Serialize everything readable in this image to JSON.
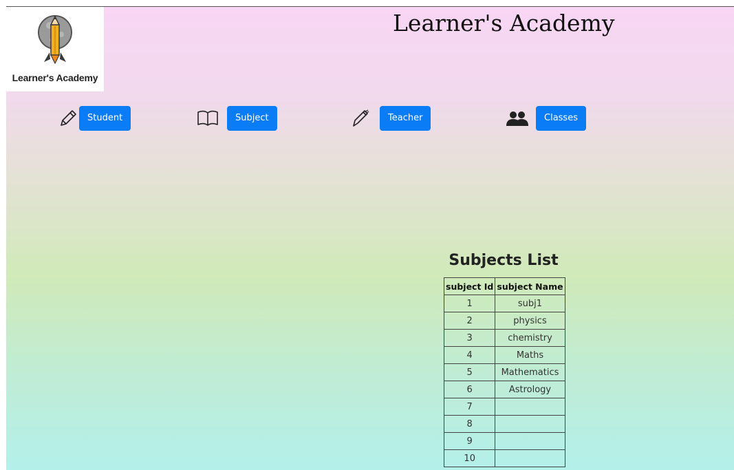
{
  "logo": {
    "text": "Learner's Academy"
  },
  "header": {
    "title": "Learner's Academy"
  },
  "nav": [
    {
      "label": "Student",
      "icon": "pencil-icon"
    },
    {
      "label": "Subject",
      "icon": "book-icon"
    },
    {
      "label": "Teacher",
      "icon": "pen-icon"
    },
    {
      "label": "Classes",
      "icon": "people-icon"
    }
  ],
  "colors": {
    "button": "#0a7cf5"
  },
  "subjects": {
    "title": "Subjects List",
    "columns": [
      "subject Id",
      "subject Name"
    ],
    "rows": [
      {
        "id": "1",
        "name": "subj1"
      },
      {
        "id": "2",
        "name": "physics"
      },
      {
        "id": "3",
        "name": "chemistry"
      },
      {
        "id": "4",
        "name": "Maths"
      },
      {
        "id": "5",
        "name": "Mathematics"
      },
      {
        "id": "6",
        "name": "Astrology"
      },
      {
        "id": "7",
        "name": ""
      },
      {
        "id": "8",
        "name": ""
      },
      {
        "id": "9",
        "name": ""
      },
      {
        "id": "10",
        "name": ""
      }
    ]
  }
}
